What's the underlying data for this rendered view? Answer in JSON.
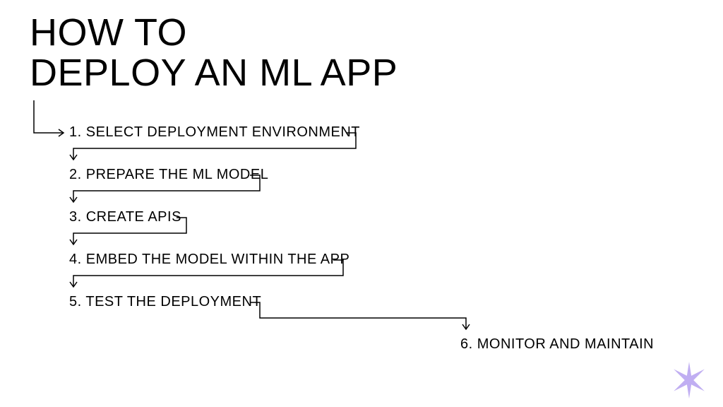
{
  "title_line1": "HOW TO",
  "title_line2": "DEPLOY AN ML APP",
  "steps": {
    "s1": "1. SELECT DEPLOYMENT ENVIRONMENT",
    "s2": "2. PREPARE THE ML MODEL",
    "s3": "3. CREATE APIS",
    "s4": "4. EMBED THE MODEL WITHIN THE APP",
    "s5": "5. TEST THE DEPLOYMENT",
    "s6": "6. MONITOR AND MAINTAIN"
  },
  "colors": {
    "line": "#000000",
    "star": "#C0AEF2"
  }
}
